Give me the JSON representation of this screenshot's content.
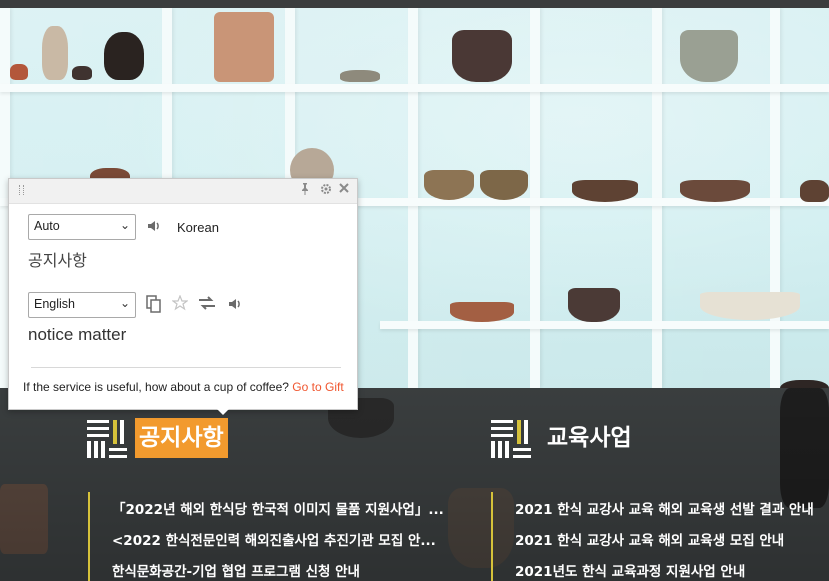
{
  "translator": {
    "source_lang": "Auto",
    "detected_lang": "Korean",
    "source_text": "공지사항",
    "target_lang": "English",
    "result_text": "notice matter",
    "footer_text": "If the service is useful, how about a cup of coffee?",
    "footer_link": "Go to Gift",
    "header_icons": [
      "pin-icon",
      "settings-icon",
      "close-icon"
    ],
    "tool_icons": [
      "copy-icon",
      "star-icon",
      "swap-icon",
      "speaker-icon"
    ]
  },
  "sections": [
    {
      "title": "공지사항",
      "active": true,
      "accent": "#f29a2e"
    },
    {
      "title": "교육사업",
      "active": false
    }
  ],
  "notices": [
    "「2022년 해외 한식당 한국적 이미지 물품 지원사업」...",
    "<2022 한식전문인력 해외진출사업 추진기관 모집 안...",
    "한식문화공간-기업 협업 프로그램 신청 안내"
  ],
  "education": [
    "2021 한식 교강사 교육 해외 교육생 선발 결과 안내",
    "2021 한식 교강사 교육 해외 교육생 모집 안내",
    "2021년도 한식 교육과정 지원사업 안내"
  ],
  "colors": {
    "band": "#3d4142",
    "accent_line": "#d6c23a",
    "link": "#f0562f"
  }
}
